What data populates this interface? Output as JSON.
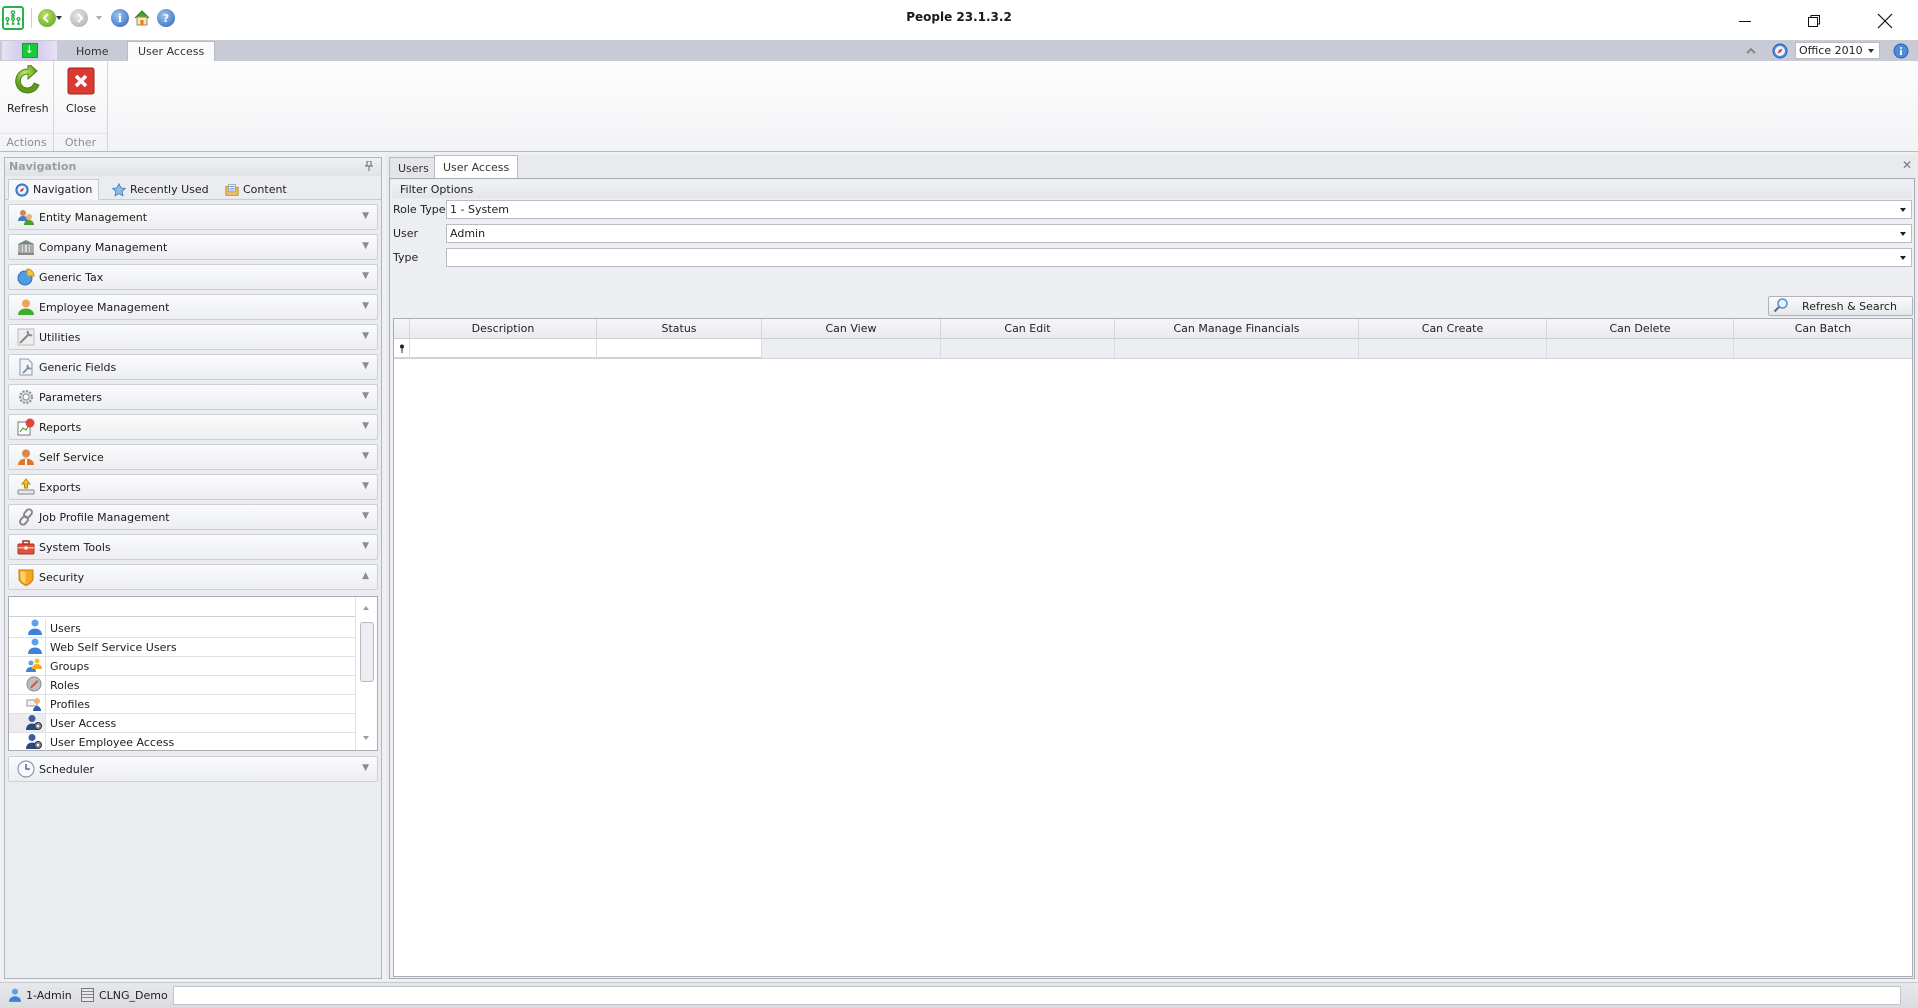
{
  "window": {
    "title": "People 23.1.3.2",
    "controls": {
      "minimize": "minimize",
      "restore": "restore",
      "close": "close"
    }
  },
  "quick_access": {
    "icons": [
      "app-logo-icon",
      "back-icon",
      "forward-icon",
      "info-icon",
      "home-icon",
      "help-icon"
    ]
  },
  "ribbon": {
    "tabs": [
      {
        "label": "Home",
        "active": false
      },
      {
        "label": "User Access",
        "active": true
      }
    ],
    "theme": {
      "selected": "Office 2010"
    },
    "groups": [
      {
        "label": "Actions",
        "buttons": [
          {
            "label": "Refresh",
            "icon": "refresh-icon"
          }
        ]
      },
      {
        "label": "Other",
        "buttons": [
          {
            "label": "Close",
            "icon": "close-icon"
          }
        ]
      }
    ]
  },
  "navigation": {
    "title": "Navigation",
    "tabs": [
      {
        "label": "Navigation",
        "icon": "compass-icon",
        "active": true
      },
      {
        "label": "Recently Used",
        "icon": "star-icon",
        "active": false
      },
      {
        "label": "Content",
        "icon": "folder-icon",
        "active": false
      }
    ],
    "groups": [
      {
        "label": "Entity Management",
        "icon": "entity-icon",
        "expanded": false
      },
      {
        "label": "Company Management",
        "icon": "bank-icon",
        "expanded": false
      },
      {
        "label": "Generic Tax",
        "icon": "pie-chart-icon",
        "expanded": false
      },
      {
        "label": "Employee Management",
        "icon": "employee-icon",
        "expanded": false
      },
      {
        "label": "Utilities",
        "icon": "wrench-icon",
        "expanded": false
      },
      {
        "label": "Generic Fields",
        "icon": "document-wrench-icon",
        "expanded": false
      },
      {
        "label": "Parameters",
        "icon": "gear-icon",
        "expanded": false
      },
      {
        "label": "Reports",
        "icon": "report-icon",
        "expanded": false
      },
      {
        "label": "Self Service",
        "icon": "self-service-icon",
        "expanded": false
      },
      {
        "label": "Exports",
        "icon": "export-icon",
        "expanded": false
      },
      {
        "label": "Job Profile Management",
        "icon": "chain-link-icon",
        "expanded": false
      },
      {
        "label": "System Tools",
        "icon": "toolbox-icon",
        "expanded": false
      },
      {
        "label": "Security",
        "icon": "shield-icon",
        "expanded": true
      }
    ],
    "security_items": [
      {
        "label": "Users",
        "icon": "user-icon",
        "selected": false
      },
      {
        "label": "Web Self Service Users",
        "icon": "user-icon",
        "selected": false
      },
      {
        "label": "Groups",
        "icon": "group-icon",
        "selected": false
      },
      {
        "label": "Roles",
        "icon": "roles-icon",
        "selected": false
      },
      {
        "label": "Profiles",
        "icon": "profiles-icon",
        "selected": false
      },
      {
        "label": "User Access",
        "icon": "user-access-icon",
        "selected": true
      },
      {
        "label": "User Employee Access",
        "icon": "user-access-icon",
        "selected": false
      }
    ],
    "after_groups": [
      {
        "label": "Scheduler",
        "icon": "clock-icon",
        "expanded": false
      }
    ]
  },
  "document": {
    "tabs": [
      {
        "label": "Users",
        "active": false
      },
      {
        "label": "User Access",
        "active": true
      }
    ],
    "filter": {
      "title": "Filter Options",
      "fields": [
        {
          "label": "Role Type",
          "value": "1 - System"
        },
        {
          "label": "User",
          "value": "Admin"
        },
        {
          "label": "Type",
          "value": ""
        }
      ],
      "search_button": "Refresh & Search"
    },
    "grid": {
      "columns": [
        "Description",
        "Status",
        "Can View",
        "Can Edit",
        "Can Manage Financials",
        "Can Create",
        "Can Delete",
        "Can Batch"
      ],
      "rows": []
    }
  },
  "statusbar": {
    "user": "1-Admin",
    "database": "CLNG_Demo",
    "message": ""
  }
}
